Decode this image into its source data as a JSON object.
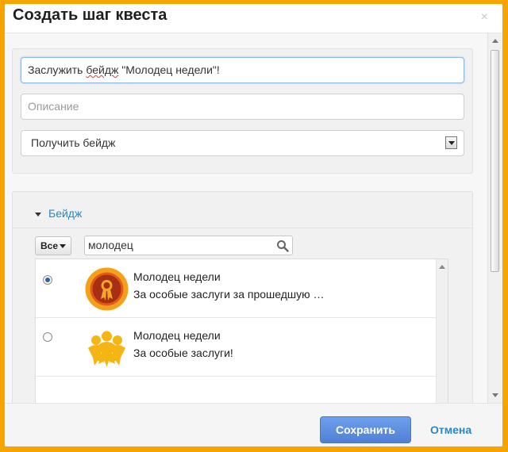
{
  "dialog": {
    "title": "Создать шаг квеста",
    "close_glyph": "×"
  },
  "form": {
    "name_value_prefix": "Заслужить ",
    "name_value_misspelled": "бейдж",
    "name_value_suffix": " \"Молодец недели\"!",
    "description_placeholder": "Описание",
    "action_selected": "Получить бейдж"
  },
  "badge_section": {
    "title": "Бейдж",
    "filter_label": "Все",
    "search_value": "молодец",
    "items": [
      {
        "name": "Молодец недели",
        "description": "За особые заслуги за прошедшую …",
        "selected": true,
        "icon": "ribbon-medal-icon"
      },
      {
        "name": "Молодец недели",
        "description": "За особые заслуги!",
        "selected": false,
        "icon": "people-group-icon"
      }
    ]
  },
  "footer": {
    "save_label": "Сохранить",
    "cancel_label": "Отмена"
  },
  "colors": {
    "frame": "#f6a400",
    "accent_link": "#2a87c2",
    "primary_button": "#5a8ce0"
  }
}
